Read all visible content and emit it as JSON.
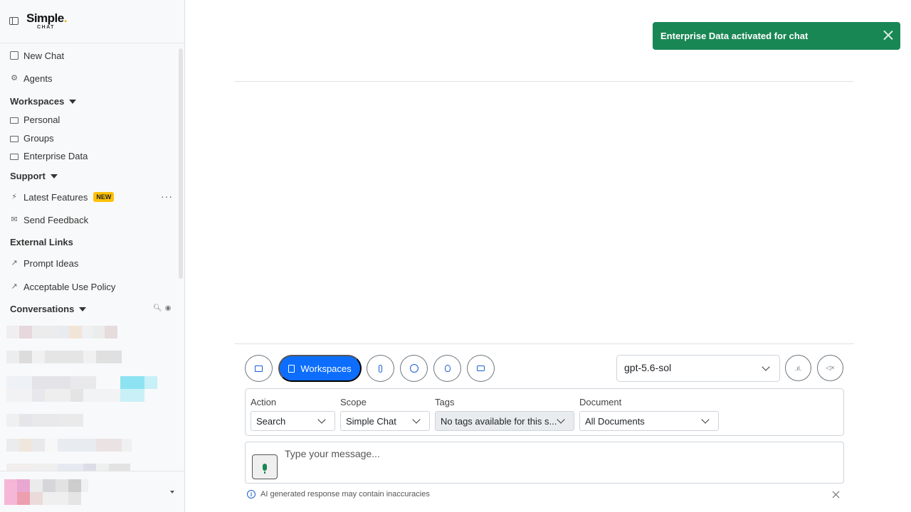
{
  "brand": {
    "name": "Simple",
    "name_dot": ".",
    "sub": "CHAT"
  },
  "sidebar": {
    "new_chat": "New Chat",
    "agents": "Agents",
    "workspaces_heading": "Workspaces",
    "workspaces": [
      "Personal",
      "Groups",
      "Enterprise Data"
    ],
    "support_heading": "Support",
    "latest_features": "Latest Features",
    "new_badge": "NEW",
    "send_feedback": "Send Feedback",
    "external_heading": "External Links",
    "prompt_ideas": "Prompt Ideas",
    "acceptable_use": "Acceptable Use Policy",
    "conversations_heading": "Conversations"
  },
  "toast": {
    "message": "Enterprise Data activated for chat"
  },
  "toolbar": {
    "workspaces_label": "Workspaces",
    "model": "gpt-5.6-sol"
  },
  "filters": {
    "action_label": "Action",
    "action_value": "Search",
    "scope_label": "Scope",
    "scope_value": "Simple Chat",
    "tags_label": "Tags",
    "tags_value": "No tags available for this s...",
    "document_label": "Document",
    "document_value": "All Documents"
  },
  "composer": {
    "placeholder": "Type your message..."
  },
  "disclaimer": {
    "text": "AI generated response may contain inaccuracies"
  },
  "colors": {
    "primary": "#0d6efd",
    "success": "#198754",
    "badge": "#ffc107"
  }
}
